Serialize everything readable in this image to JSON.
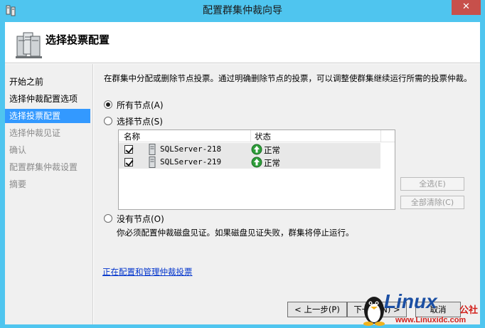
{
  "window": {
    "title": "配置群集仲裁向导",
    "close_label": "✕"
  },
  "header": {
    "title": "选择投票配置"
  },
  "sidebar": {
    "items": [
      {
        "label": "开始之前",
        "state": "done"
      },
      {
        "label": "选择仲裁配置选项",
        "state": "done"
      },
      {
        "label": "选择投票配置",
        "state": "active"
      },
      {
        "label": "选择仲裁见证",
        "state": "disabled"
      },
      {
        "label": "确认",
        "state": "disabled"
      },
      {
        "label": "配置群集仲裁设置",
        "state": "disabled"
      },
      {
        "label": "摘要",
        "state": "disabled"
      }
    ]
  },
  "content": {
    "description": "在群集中分配或删除节点投票。通过明确删除节点的投票，可以调整使群集继续运行所需的投票仲裁。",
    "options": {
      "all_nodes": "所有节点(A)",
      "select_nodes": "选择节点(S)",
      "no_nodes": "没有节点(O)",
      "selected": "all_nodes"
    },
    "node_table": {
      "columns": [
        "名称",
        "状态"
      ],
      "rows": [
        {
          "checked": true,
          "name": "SQLServer-218",
          "status": "正常"
        },
        {
          "checked": true,
          "name": "SQLServer-219",
          "status": "正常"
        }
      ]
    },
    "select_all_button": "全选(E)",
    "clear_all_button": "全部清除(C)",
    "no_nodes_warning": "你必须配置仲裁磁盘见证。如果磁盘见证失败，群集将停止运行。",
    "help_link": "正在配置和管理仲裁投票"
  },
  "footer": {
    "back_button": "< 上一步(P)",
    "next_button": "下一步(N) >",
    "cancel_button": "取消"
  },
  "watermark": {
    "brand": "Linux",
    "suffix": "公社",
    "url": "www.Linuxidc.com"
  },
  "colors": {
    "titlebar": "#4fc5ef",
    "close": "#c7504b",
    "active_step": "#3399ff",
    "link": "#0033cc",
    "status_ok": "#2e9e3a"
  }
}
